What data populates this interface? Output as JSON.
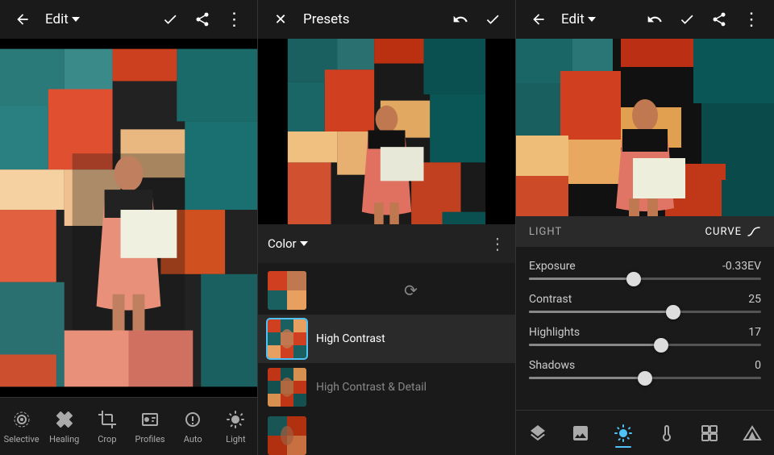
{
  "panel1": {
    "header": {
      "back_icon": "←",
      "title": "Edit",
      "title_has_dropdown": true,
      "check_icon": "✓",
      "share_icon": "⬆",
      "more_icon": "⋮"
    },
    "toolbar": {
      "items": [
        {
          "id": "selective",
          "label": "Selective",
          "active": false
        },
        {
          "id": "healing",
          "label": "Healing",
          "active": false
        },
        {
          "id": "crop",
          "label": "Crop",
          "active": false
        },
        {
          "id": "profiles",
          "label": "Profiles",
          "active": false
        },
        {
          "id": "auto",
          "label": "Auto",
          "active": false
        },
        {
          "id": "light",
          "label": "Light",
          "active": false
        }
      ]
    }
  },
  "panel2": {
    "header": {
      "close_icon": "✕",
      "title": "Presets",
      "undo_icon": "↩",
      "check_icon": "✓"
    },
    "filter_bar": {
      "category": "Color",
      "has_dropdown": true,
      "more_icon": "⋮"
    },
    "presets": [
      {
        "id": "loading",
        "type": "loading",
        "thumb": null,
        "name": ""
      },
      {
        "id": "high-contrast",
        "type": "item",
        "name": "High Contrast",
        "active": true
      },
      {
        "id": "high-contrast-detail",
        "type": "item",
        "name": "High Contrast & Detail",
        "active": false,
        "faded": true
      },
      {
        "id": "item3",
        "type": "item",
        "name": "",
        "active": false,
        "faded": false
      }
    ]
  },
  "panel3": {
    "header": {
      "back_icon": "←",
      "title": "Edit",
      "title_has_dropdown": true,
      "undo_icon": "↩",
      "check_icon": "✓",
      "share_icon": "⬆",
      "more_icon": "⋮"
    },
    "light_section": {
      "label": "LIGHT",
      "curve_button": "CURVE"
    },
    "adjustments": [
      {
        "id": "exposure",
        "name": "Exposure",
        "value": "-0.33EV",
        "position": 45,
        "fill_left": false
      },
      {
        "id": "contrast",
        "name": "Contrast",
        "value": "25",
        "position": 62,
        "fill_left": false
      },
      {
        "id": "highlights",
        "name": "Highlights",
        "value": "17",
        "position": 57,
        "fill_left": false
      },
      {
        "id": "shadows",
        "name": "Shadows",
        "value": "0",
        "position": 50,
        "fill_left": false
      }
    ],
    "bottom_icons": [
      {
        "id": "layers",
        "label": "layers"
      },
      {
        "id": "photo",
        "label": "photo"
      },
      {
        "id": "light-adjust",
        "label": "light",
        "active": true
      },
      {
        "id": "temp",
        "label": "temperature"
      },
      {
        "id": "detail",
        "label": "detail"
      },
      {
        "id": "triangle",
        "label": "triangle"
      }
    ]
  }
}
